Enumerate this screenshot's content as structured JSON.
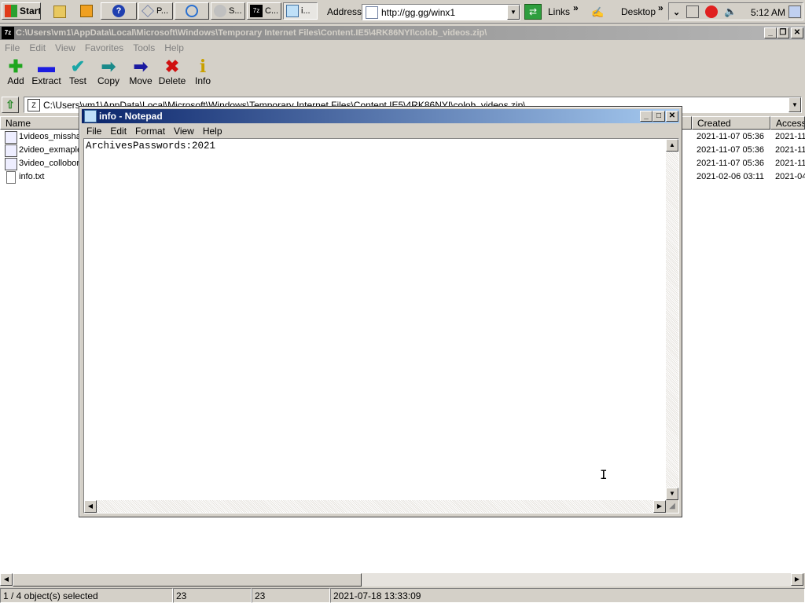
{
  "taskbar": {
    "start_label": "Start",
    "buttons": [
      {
        "label": "P..."
      },
      {
        "label": "S..."
      },
      {
        "label": "C..."
      },
      {
        "label": "i..."
      }
    ],
    "address_label": "Address",
    "address_value": "http://gg.gg/winx1",
    "links_label": "Links",
    "desktop_label": "Desktop",
    "clock": "5:12 AM"
  },
  "zip_window": {
    "title": "C:\\Users\\vm1\\AppData\\Local\\Microsoft\\Windows\\Temporary Internet Files\\Content.IE5\\4RK86NYI\\colob_videos.zip\\",
    "menu": [
      "File",
      "Edit",
      "View",
      "Favorites",
      "Tools",
      "Help"
    ],
    "tools": [
      {
        "label": "Add",
        "icon": "plus-icon",
        "color": "#1fa61f",
        "glyph": "✚"
      },
      {
        "label": "Extract",
        "icon": "minus-icon",
        "color": "#1c1ce0",
        "glyph": "▬"
      },
      {
        "label": "Test",
        "icon": "check-icon",
        "color": "#1aa6a6",
        "glyph": "✔"
      },
      {
        "label": "Copy",
        "icon": "copy-arrow-icon",
        "color": "#1a8a8a",
        "glyph": "➡"
      },
      {
        "label": "Move",
        "icon": "move-arrow-icon",
        "color": "#1a1aa0",
        "glyph": "➡"
      },
      {
        "label": "Delete",
        "icon": "delete-x-icon",
        "color": "#d01010",
        "glyph": "✖"
      },
      {
        "label": "Info",
        "icon": "info-icon",
        "color": "#c8a000",
        "glyph": "i"
      }
    ],
    "path_value": "C:\\Users\\vm1\\AppData\\Local\\Microsoft\\Windows\\Temporary Internet Files\\Content.IE5\\4RK86NYI\\colob_videos.zip\\",
    "columns": {
      "name": "Name",
      "created": "Created",
      "accessed": "Access"
    },
    "files": [
      {
        "name": "1videos_missha",
        "created": "2021-11-07 05:36",
        "accessed": "2021-11"
      },
      {
        "name": "2video_exmaple",
        "created": "2021-11-07 05:36",
        "accessed": "2021-11"
      },
      {
        "name": "3video_collobor",
        "created": "2021-11-07 05:36",
        "accessed": "2021-11"
      },
      {
        "name": "info.txt",
        "created": "2021-02-06 03:11",
        "accessed": "2021-04"
      }
    ],
    "status": {
      "selected": "1 / 4 object(s) selected",
      "size1": "23",
      "size2": "23",
      "modified": "2021-07-18 13:33:09"
    }
  },
  "notepad": {
    "title": "info - Notepad",
    "menu": [
      "File",
      "Edit",
      "Format",
      "View",
      "Help"
    ],
    "content": "ArchivesPasswords:2021"
  }
}
